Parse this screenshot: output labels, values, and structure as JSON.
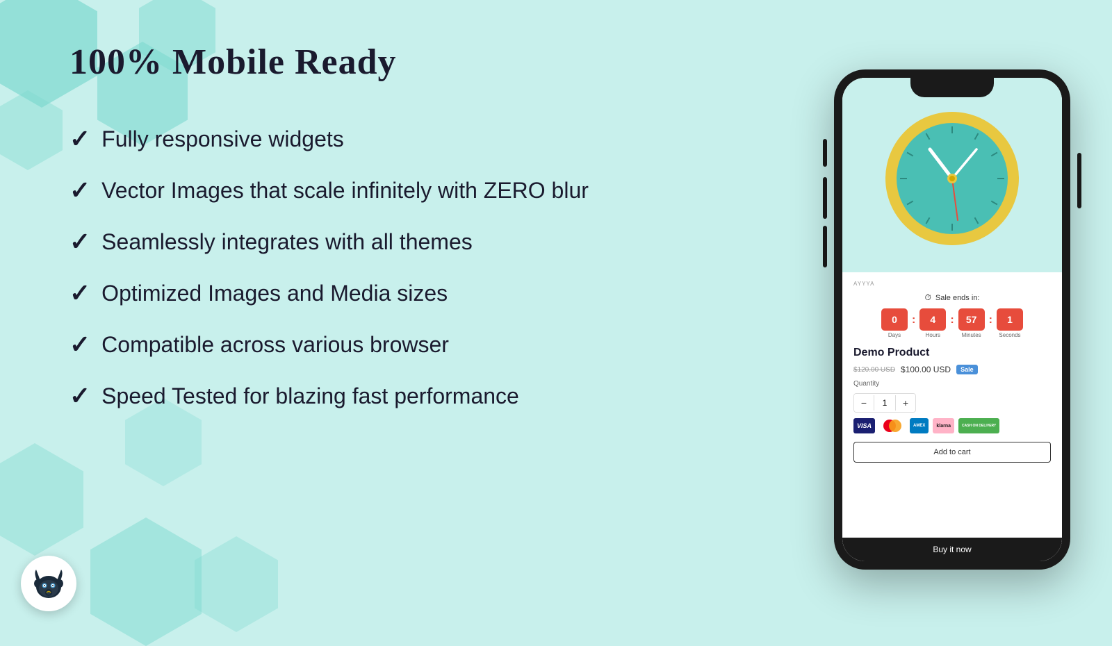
{
  "header": {
    "title": "100% Mobile Ready"
  },
  "features": [
    {
      "id": 1,
      "text": "Fully responsive widgets"
    },
    {
      "id": 2,
      "text": "Vector Images that scale infinitely with ZERO blur"
    },
    {
      "id": 3,
      "text": "Seamlessly integrates with all themes"
    },
    {
      "id": 4,
      "text": "Optimized Images and Media sizes"
    },
    {
      "id": 5,
      "text": "Compatible across various browser"
    },
    {
      "id": 6,
      "text": "Speed Tested for blazing fast performance"
    }
  ],
  "phone": {
    "brand": "AYYYA",
    "sale_ends_in": "Sale ends in:",
    "countdown": {
      "days": {
        "value": "0",
        "label": "Days"
      },
      "hours": {
        "value": "4",
        "label": "Hours"
      },
      "minutes": {
        "value": "57",
        "label": "Minutes"
      },
      "seconds": {
        "value": "1",
        "label": "Seconds"
      }
    },
    "product_name": "Demo Product",
    "price_original": "$120.00 USD",
    "price_current": "$100.00 USD",
    "sale_badge": "Sale",
    "quantity_label": "Quantity",
    "quantity_value": "1",
    "add_to_cart": "Add to cart",
    "buy_now": "Buy it now"
  },
  "checkmark": "✓"
}
